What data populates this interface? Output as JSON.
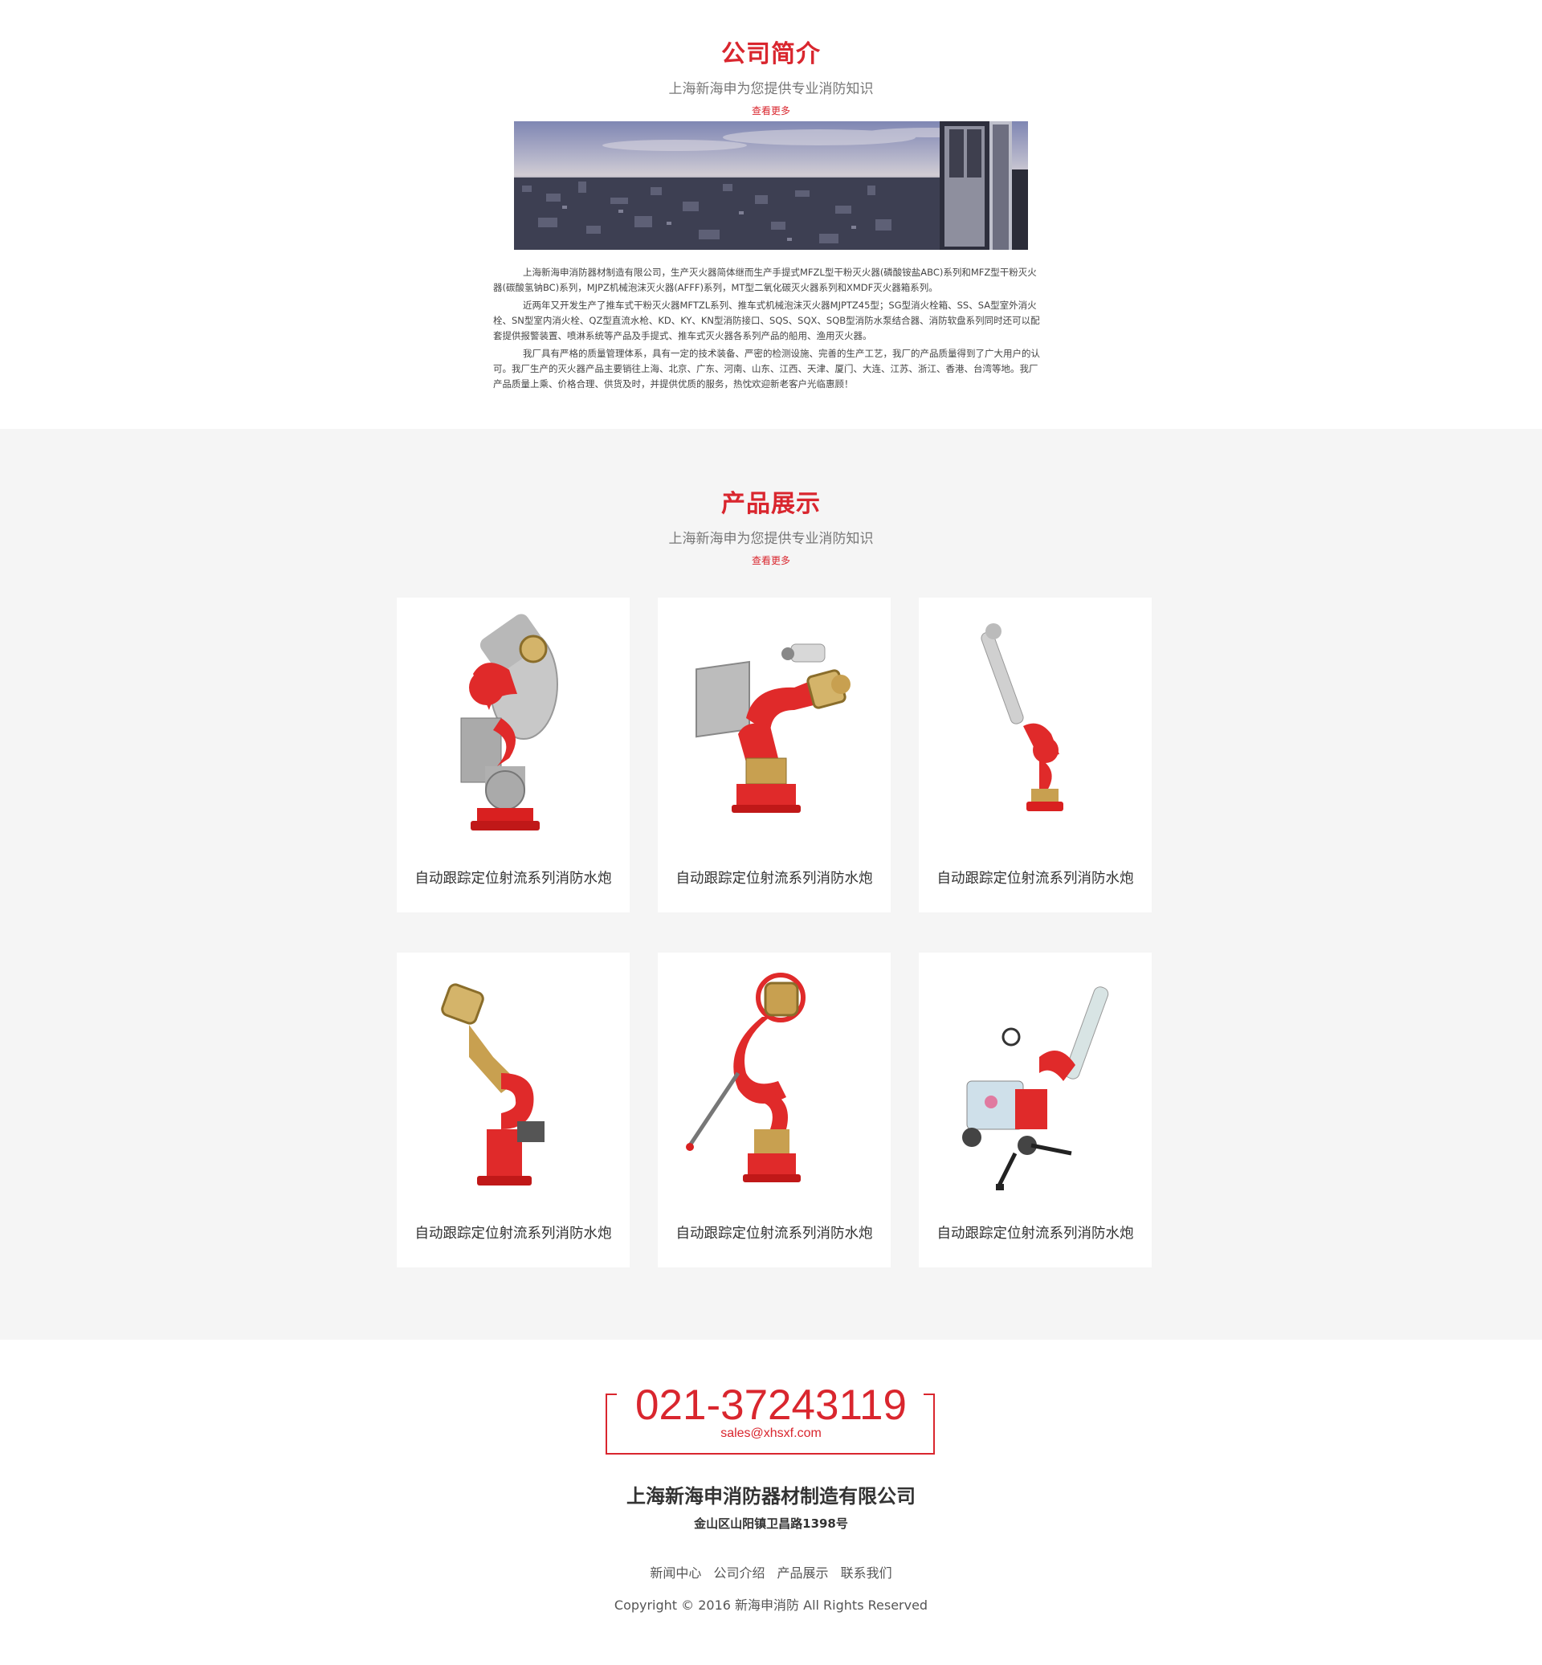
{
  "about": {
    "title": "公司简介",
    "subtitle": "上海新海申为您提供专业消防知识",
    "more": "查看更多",
    "paragraphs": [
      "上海新海申消防器材制造有限公司，生产灭火器简体继而生产手提式MFZL型干粉灭火器(磷酸铵盐ABC)系列和MFZ型干粉灭火器(碳酸氢钠BC)系列，MJPZ机械泡沫灭火器(AFFF)系列，MT型二氧化碳灭火器系列和XMDF灭火器箱系列。",
      "近两年又开发生产了推车式干粉灭火器MFTZL系列、推车式机械泡沫灭火器MJPTZ45型；SG型消火栓箱、SS、SA型室外消火栓、SN型室内消火栓、QZ型直流水枪、KD、KY、KN型消防接口、SQS、SQX、SQB型消防水泵结合器、消防软盘系列同时还可以配套提供报警装置、喷淋系统等产品及手提式、推车式灭火器各系列产品的船用、渔用灭火器。",
      "我厂具有严格的质量管理体系，具有一定的技术装备、严密的检测设施、完善的生产工艺，我厂的产品质量得到了广大用户的认可。我厂生产的灭火器产品主要销往上海、北京、广东、河南、山东、江西、天津、厦门、大连、江苏、浙江、香港、台湾等地。我厂产品质量上乘、价格合理、供货及时，并提供优质的服务，热忱欢迎新老客户光临惠顾！"
    ]
  },
  "products": {
    "title": "产品展示",
    "subtitle": "上海新海申为您提供专业消防知识",
    "more": "查看更多",
    "items": [
      {
        "name": "自动跟踪定位射流系列消防水炮"
      },
      {
        "name": "自动跟踪定位射流系列消防水炮"
      },
      {
        "name": "自动跟踪定位射流系列消防水炮"
      },
      {
        "name": "自动跟踪定位射流系列消防水炮"
      },
      {
        "name": "自动跟踪定位射流系列消防水炮"
      },
      {
        "name": "自动跟踪定位射流系列消防水炮"
      }
    ]
  },
  "footer": {
    "phone": "021-37243119",
    "email": "sales@xhsxf.com",
    "company": "上海新海申消防器材制造有限公司",
    "address": "金山区山阳镇卫昌路1398号",
    "nav": [
      "新闻中心",
      "公司介绍",
      "产品展示",
      "联系我们"
    ],
    "copyright": "Copyright © 2016 新海申消防 All Rights Reserved"
  },
  "colors": {
    "accent": "#d9262e",
    "products_bg": "#f5f5f5",
    "card_bg": "#ffffff"
  }
}
